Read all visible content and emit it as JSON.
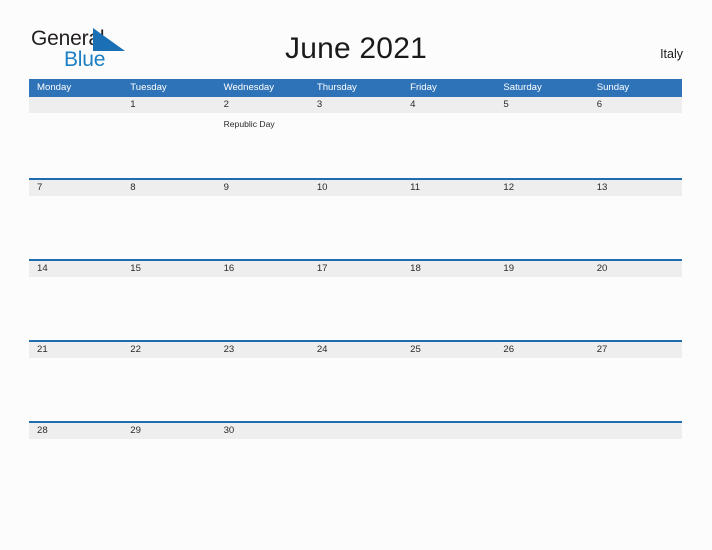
{
  "brand": {
    "name_part1": "General",
    "name_part2": "Blue",
    "flag_icon": "blue-triangle-flag-icon",
    "color_primary": "#1b7fc4",
    "color_text": "#231f20"
  },
  "header": {
    "title": "June 2021",
    "country": "Italy"
  },
  "theme": {
    "header_blue": "#2e73b8",
    "row_divider_blue": "#1f6cb0",
    "band_gray": "#eeeeee",
    "page_background": "#fcfcfc",
    "text_dark": "#2a2a2a"
  },
  "calendar": {
    "weekdays": [
      "Monday",
      "Tuesday",
      "Wednesday",
      "Thursday",
      "Friday",
      "Saturday",
      "Sunday"
    ],
    "weeks": [
      [
        {
          "num": "",
          "event": ""
        },
        {
          "num": "1",
          "event": ""
        },
        {
          "num": "2",
          "event": "Republic Day"
        },
        {
          "num": "3",
          "event": ""
        },
        {
          "num": "4",
          "event": ""
        },
        {
          "num": "5",
          "event": ""
        },
        {
          "num": "6",
          "event": ""
        }
      ],
      [
        {
          "num": "7",
          "event": ""
        },
        {
          "num": "8",
          "event": ""
        },
        {
          "num": "9",
          "event": ""
        },
        {
          "num": "10",
          "event": ""
        },
        {
          "num": "11",
          "event": ""
        },
        {
          "num": "12",
          "event": ""
        },
        {
          "num": "13",
          "event": ""
        }
      ],
      [
        {
          "num": "14",
          "event": ""
        },
        {
          "num": "15",
          "event": ""
        },
        {
          "num": "16",
          "event": ""
        },
        {
          "num": "17",
          "event": ""
        },
        {
          "num": "18",
          "event": ""
        },
        {
          "num": "19",
          "event": ""
        },
        {
          "num": "20",
          "event": ""
        }
      ],
      [
        {
          "num": "21",
          "event": ""
        },
        {
          "num": "22",
          "event": ""
        },
        {
          "num": "23",
          "event": ""
        },
        {
          "num": "24",
          "event": ""
        },
        {
          "num": "25",
          "event": ""
        },
        {
          "num": "26",
          "event": ""
        },
        {
          "num": "27",
          "event": ""
        }
      ],
      [
        {
          "num": "28",
          "event": ""
        },
        {
          "num": "29",
          "event": ""
        },
        {
          "num": "30",
          "event": ""
        },
        {
          "num": "",
          "event": ""
        },
        {
          "num": "",
          "event": ""
        },
        {
          "num": "",
          "event": ""
        },
        {
          "num": "",
          "event": ""
        }
      ]
    ]
  }
}
